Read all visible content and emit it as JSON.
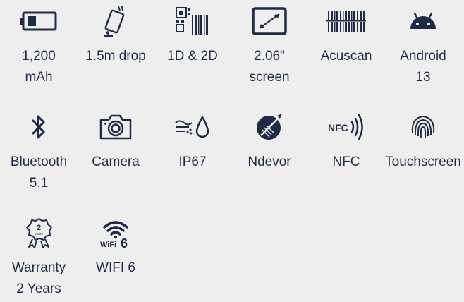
{
  "accent_color": "#1f2a44",
  "background_color": "#eeeeee",
  "features": [
    {
      "icon": "battery-icon",
      "label": "1,200\nmAh"
    },
    {
      "icon": "drop-icon",
      "label": "1.5m drop"
    },
    {
      "icon": "barcode-qr-icon",
      "label": "1D & 2D"
    },
    {
      "icon": "screen-size-icon",
      "label": "2.06\"\nscreen"
    },
    {
      "icon": "scanner-icon",
      "label": "Acuscan"
    },
    {
      "icon": "android-icon",
      "label": "Android\n13"
    },
    {
      "icon": "bluetooth-icon",
      "label": "Bluetooth\n5.1"
    },
    {
      "icon": "camera-icon",
      "label": "Camera"
    },
    {
      "icon": "water-dust-icon",
      "label": "IP67"
    },
    {
      "icon": "ndevor-icon",
      "label": "Ndevor"
    },
    {
      "icon": "nfc-icon",
      "label": "NFC"
    },
    {
      "icon": "touchscreen-icon",
      "label": "Touchscreen"
    },
    {
      "icon": "warranty-icon",
      "label": "Warranty\n2 Years"
    },
    {
      "icon": "wifi6-icon",
      "label": "WIFI 6"
    }
  ]
}
